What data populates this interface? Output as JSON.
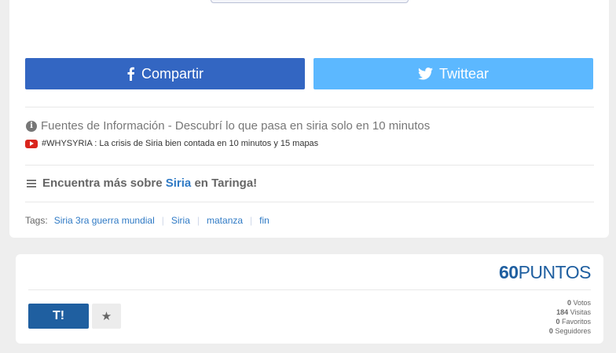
{
  "share": {
    "facebook_label": "Compartir",
    "twitter_label": "Twittear"
  },
  "sources": {
    "title": "Fuentes de Información - Descubrí lo que pasa en siria solo en 10 minutos",
    "items": [
      {
        "text": "#WHYSYRIA : La crisis de Siria bien contada en 10 minutos y 15 mapas"
      }
    ]
  },
  "more": {
    "prefix": "Encuentra más sobre",
    "topic": "Siria",
    "suffix": "en Taringa!"
  },
  "tags": {
    "label": "Tags:",
    "items": [
      "Siria 3ra guerra mundial",
      "Siria",
      "matanza",
      "fin"
    ],
    "separator": "|"
  },
  "post": {
    "points_value": "60",
    "points_label": "PUNTOS",
    "t_button_label": "T!",
    "fav_glyph": "★",
    "stats": [
      {
        "value": "0",
        "label": "Votos"
      },
      {
        "value": "184",
        "label": "Visitas"
      },
      {
        "value": "0",
        "label": "Favoritos"
      },
      {
        "value": "0",
        "label": "Seguidores"
      }
    ]
  },
  "colors": {
    "facebook": "#3366c2",
    "twitter": "#5cb8ff",
    "link": "#2f7ac5",
    "brand": "#1f5fa0"
  }
}
